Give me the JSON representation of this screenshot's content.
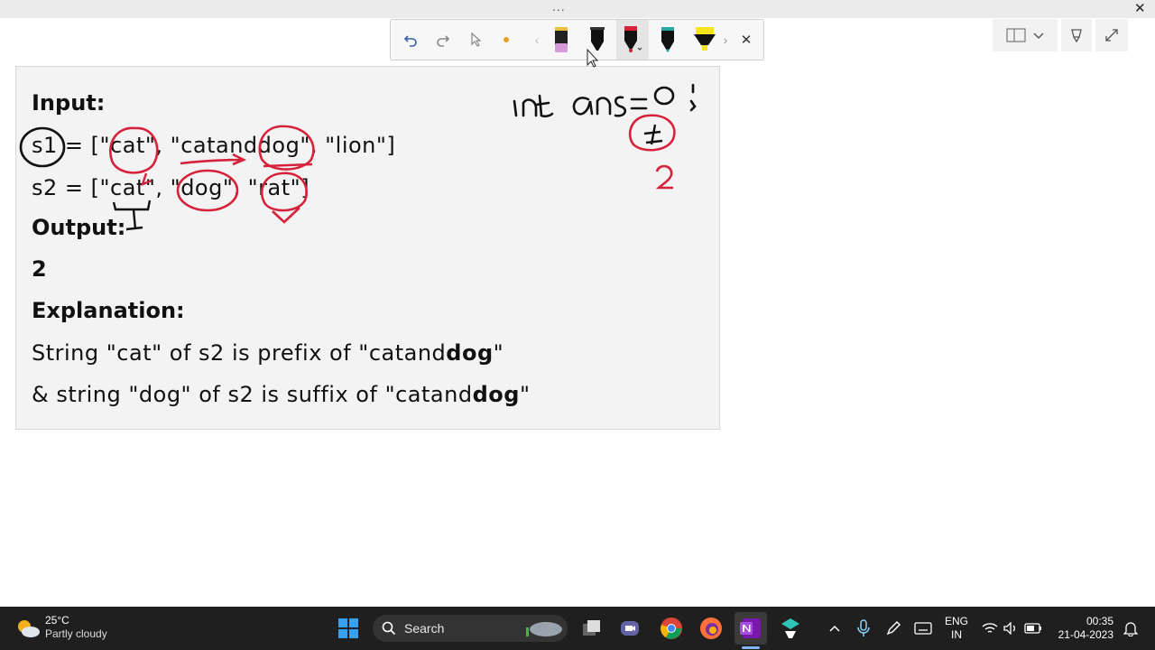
{
  "window": {
    "menu_dots": "...",
    "close_glyph": "✕"
  },
  "pen_toolbar": {
    "tools": [
      "undo-icon",
      "redo-icon",
      "lasso-select-icon",
      "dot-icon",
      "scroll-left-icon",
      "eraser-pen",
      "black-pen",
      "red-pen",
      "teal-pen",
      "yellow-highlighter",
      "scroll-right-icon",
      "close-icon"
    ]
  },
  "note": {
    "input_heading": "Input:",
    "s1_var": "s1",
    "s1_rest": " = [\"cat\", \"catanddog\", \"lion\"]",
    "s2_line": "s2 = [\"cat\", \"dog\", \"rat\"]",
    "output_heading": "Output:",
    "output_value": "2",
    "explanation_heading": "Explanation:",
    "exp1_plain": "String \"cat\" of s2 is prefix of \"catand",
    "exp1_bold": "dog",
    "exp1_end": "\"",
    "exp2_plain": "& string \"dog\" of s2 is suffix of \"catand",
    "exp2_bold": "dog",
    "exp2_end": "\""
  },
  "taskbar": {
    "temperature": "25°C",
    "weather": "Partly cloudy",
    "search_label": "Search",
    "lang_top": "ENG",
    "lang_bottom": "IN",
    "time": "00:35",
    "date": "21-04-2023"
  },
  "colors": {
    "ink_red": "#d6213a",
    "ink_black": "#111111",
    "taskbar_bg": "#1f1f1f",
    "card_bg": "#f3f3f3"
  }
}
